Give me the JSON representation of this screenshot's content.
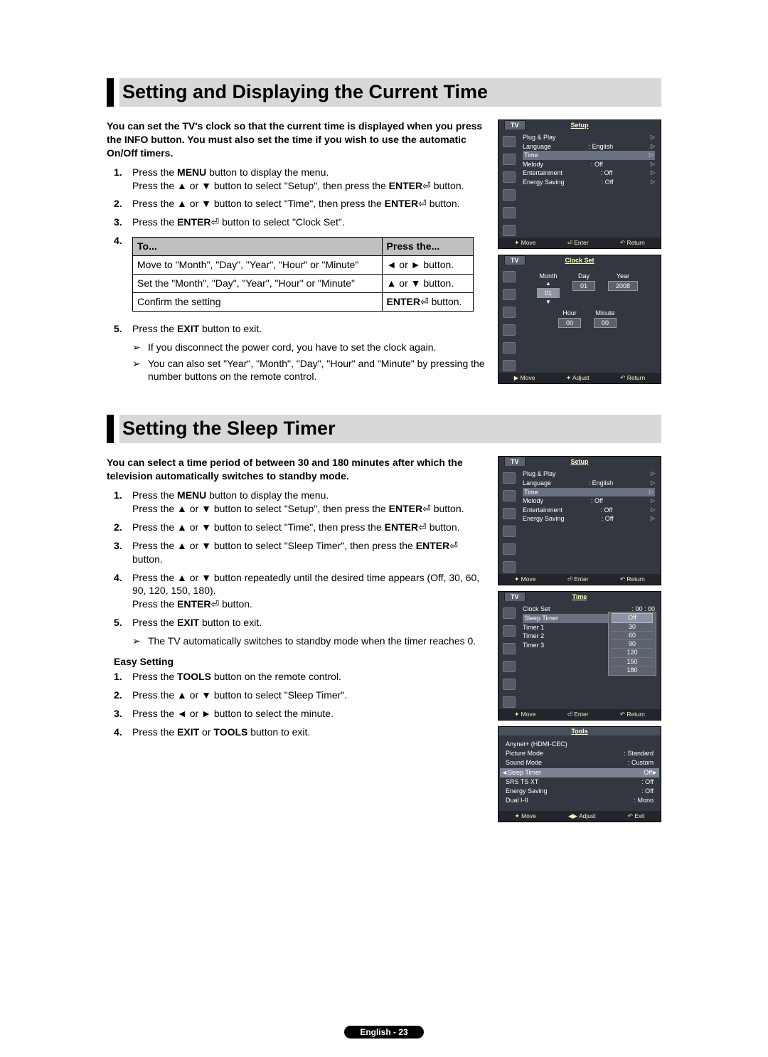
{
  "section1": {
    "title": "Setting and Displaying the Current Time",
    "intro": "You can set the TV's clock so that the current time is displayed when you press the INFO button. You must also set the time if you wish to use the automatic On/Off timers.",
    "step1a": "Press the ",
    "step1_menu": "MENU",
    "step1b": " button to display the menu.",
    "step1c": "Press the ▲ or ▼ button to select \"Setup\", then press the ",
    "step1_enter": "ENTER",
    "step1d": " button.",
    "step2a": "Press the ▲ or ▼ button to select \"Time\", then press the ",
    "step2_enter": "ENTER",
    "step2b": " button.",
    "step3a": "Press the ",
    "step3_enter": "ENTER",
    "step3b": " button to select \"Clock Set\".",
    "table": {
      "h1": "To...",
      "h2": "Press the...",
      "r1c1": "Move to \"Month\", \"Day\", \"Year\", \"Hour\" or \"Minute\"",
      "r1c2": "◄ or ► button.",
      "r2c1": "Set the \"Month\", \"Day\", \"Year\", \"Hour\" or \"Minute\"",
      "r2c2": "▲ or ▼ button.",
      "r3c1": "Confirm the setting",
      "r3c2a": "ENTER",
      "r3c2b": " button."
    },
    "step5a": "Press the ",
    "step5_exit": "EXIT",
    "step5b": " button to exit.",
    "note1": "If you disconnect the power cord, you have to set the clock again.",
    "note2": "You can also set \"Year\", \"Month\", \"Day\", \"Hour\" and \"Minute\" by pressing the number buttons on the remote control."
  },
  "section2": {
    "title": "Setting the Sleep Timer",
    "intro": "You can select a time period of between 30 and 180 minutes after which the television automatically switches to standby mode.",
    "step1a": "Press the ",
    "step1_menu": "MENU",
    "step1b": " button to display the menu.",
    "step1c": "Press the ▲ or ▼ button to select \"Setup\", then press the ",
    "step1_enter": "ENTER",
    "step1d": " button.",
    "step2a": "Press the ▲ or ▼ button to select \"Time\", then press the ",
    "step2_enter": "ENTER",
    "step2b": " button.",
    "step3a": "Press the ▲ or ▼ button to select \"Sleep Timer\", then press the ",
    "step3_enter": "ENTER",
    "step3b": " button.",
    "step4a": "Press the ▲ or ▼ button repeatedly until the desired time appears (Off, 30, 60, 90, 120, 150, 180).",
    "step4b": "Press the ",
    "step4_enter": "ENTER",
    "step4c": " button.",
    "step5a": "Press the ",
    "step5_exit": "EXIT",
    "step5b": " button to exit.",
    "note1": "The TV automatically switches to standby mode when the timer reaches 0.",
    "easy_head": "Easy Setting",
    "e1a": "Press the ",
    "e1_tools": "TOOLS",
    "e1b": " button on the remote control.",
    "e2": "Press the ▲ or ▼ button to select \"Sleep Timer\".",
    "e3": "Press the ◄ or ► button to select the minute.",
    "e4a": "Press the ",
    "e4_exit": "EXIT",
    "e4b": " or ",
    "e4_tools": "TOOLS",
    "e4c": " button to exit."
  },
  "osd": {
    "tv": "TV",
    "setup_title": "Setup",
    "setup_items": {
      "plugplay": "Plug & Play",
      "language": "Language",
      "language_val": ": English",
      "time": "Time",
      "melody": "Melody",
      "melody_val": ": Off",
      "entertainment": "Entertainment",
      "entertainment_val": ": Off",
      "energy": "Energy Saving",
      "energy_val": ": Off"
    },
    "foot_move": "Move",
    "foot_enter": "Enter",
    "foot_return": "Return",
    "foot_adjust": "Adjust",
    "foot_exit": "Exit",
    "clock_title": "Clock Set",
    "clock": {
      "month": "Month",
      "month_v": "01",
      "day": "Day",
      "day_v": "01",
      "year": "Year",
      "year_v": "2008",
      "hour": "Hour",
      "hour_v": "00",
      "minute": "Minute",
      "minute_v": "00"
    },
    "time_title": "Time",
    "time_menu": {
      "clockset": "Clock Set",
      "clockset_v": ": 00 : 00",
      "sleep": "Sleep Timer",
      "t1": "Timer 1",
      "t1_v": ":",
      "t2": "Timer 2",
      "t2_v": ":",
      "t3": "Timer 3",
      "t3_v": ":"
    },
    "sleep_opts": [
      "Off",
      "30",
      "60",
      "90",
      "120",
      "150",
      "180"
    ],
    "tools_title": "Tools",
    "tools": {
      "anynet": "Anynet+ (HDMI-CEC)",
      "picture": "Picture Mode",
      "picture_v": ": Standard",
      "sound": "Sound Mode",
      "sound_v": ": Custom",
      "sleep": "Sleep Timer",
      "sleep_v": "Off",
      "srs": "SRS TS XT",
      "srs_v": ": Off",
      "energy": "Energy Saving",
      "energy_v": ": Off",
      "dual": "Dual I-II",
      "dual_v": ": Mono"
    }
  },
  "footer": "English - 23"
}
